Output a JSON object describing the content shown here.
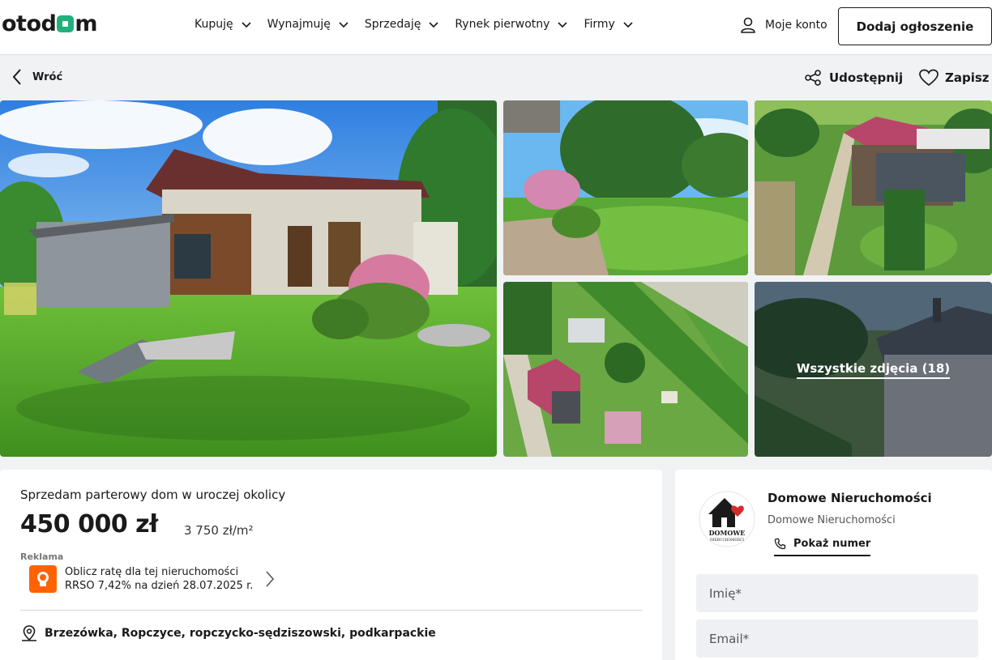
{
  "header": {
    "logo_left": "otod",
    "logo_right": "m",
    "nav": [
      "Kupuję",
      "Wynajmuję",
      "Sprzedaję",
      "Rynek pierwotny",
      "Firmy"
    ],
    "account": "Moje konto",
    "add_listing": "Dodaj ogłoszenie"
  },
  "actions": {
    "back": "Wróć",
    "share": "Udostępnij",
    "save": "Zapisz"
  },
  "gallery": {
    "all_photos": "Wszystkie zdjęcia (18)"
  },
  "listing": {
    "title": "Sprzedam parterowy dom w uroczej okolicy",
    "price": "450 000 zł",
    "price_per_m2": "3 750 zł/m²",
    "ad_label": "Reklama",
    "loan_line1": "Oblicz ratę dla tej nieruchomości",
    "loan_line2": "RRSO 7,42% na dzień 28.07.2025 r.",
    "location": "Brzezówka, Ropczyce, ropczycko-sędziszowski, podkarpackie"
  },
  "agency": {
    "name": "Domowe Nieruchomości",
    "subtitle": "Domowe Nieruchomości",
    "logo_text_1": "DOMOWE",
    "logo_text_2": "NIERUCHOMOŚCI",
    "show_number": "Pokaż numer"
  },
  "form": {
    "name_placeholder": "Imię*",
    "email_placeholder": "Email*"
  },
  "colors": {
    "brand_green": "#21b07c",
    "ing_orange": "#ff6200",
    "agency_heart": "#d62b2b"
  }
}
